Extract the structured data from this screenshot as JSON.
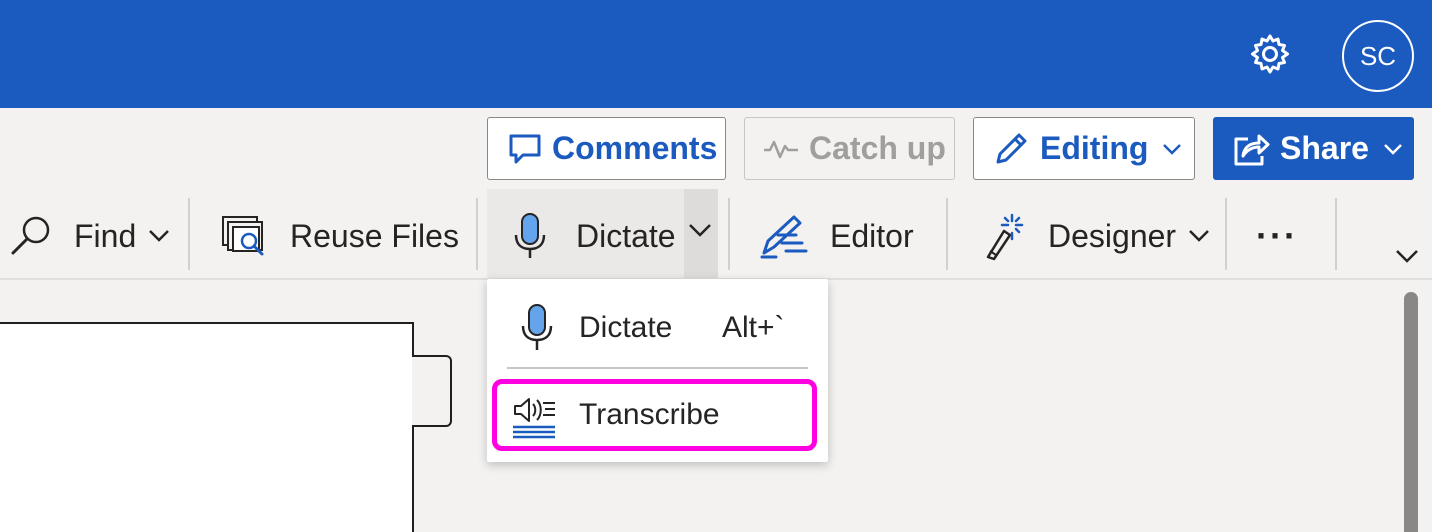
{
  "header": {
    "settings_icon": "gear-icon",
    "avatar_initials": "SC",
    "color": "#1b5abf"
  },
  "actions": {
    "comments_label": "Comments",
    "catchup_label": "Catch up",
    "editing_label": "Editing",
    "share_label": "Share"
  },
  "ribbon": {
    "find_label": "Find",
    "reuse_label": "Reuse Files",
    "dictate_label": "Dictate",
    "editor_label": "Editor",
    "designer_label": "Designer",
    "more_label": "···"
  },
  "dictate_menu": {
    "items": [
      {
        "label": "Dictate",
        "shortcut": "Alt+`",
        "icon": "microphone-icon"
      },
      {
        "label": "Transcribe",
        "icon": "transcribe-icon",
        "highlighted": true
      }
    ],
    "highlight_color": "#ff00e0"
  }
}
